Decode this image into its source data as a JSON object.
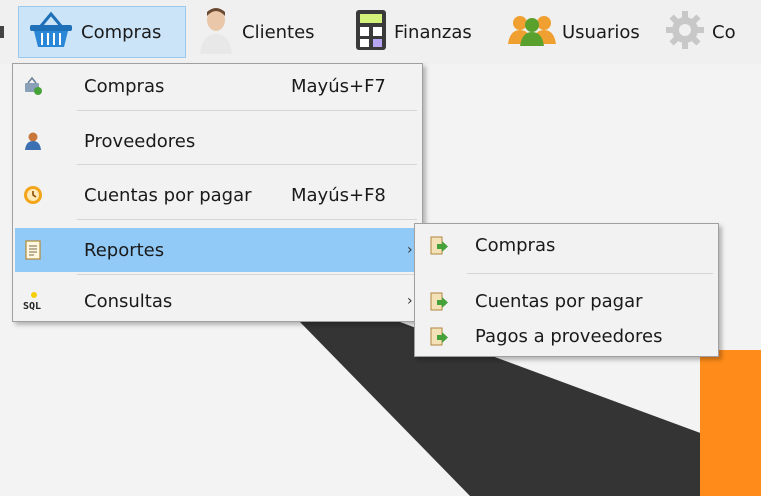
{
  "menubar": {
    "items": [
      {
        "label": "Compras",
        "icon": "basket-icon"
      },
      {
        "label": "Clientes",
        "icon": "person-icon"
      },
      {
        "label": "Finanzas",
        "icon": "calculator-icon"
      },
      {
        "label": "Usuarios",
        "icon": "users-icon"
      },
      {
        "label": "Co",
        "icon": "gear-icon"
      }
    ]
  },
  "compras_menu": {
    "items": [
      {
        "label": "Compras",
        "shortcut": "Mayús+F7",
        "icon": "purchase-icon"
      },
      {
        "label": "Proveedores",
        "shortcut": "",
        "icon": "supplier-icon"
      },
      {
        "label": "Cuentas por pagar",
        "shortcut": "Mayús+F8",
        "icon": "clock-icon"
      },
      {
        "label": "Reportes",
        "shortcut": "",
        "icon": "report-icon",
        "has_submenu": true,
        "highlighted": true
      },
      {
        "label": "Consultas",
        "shortcut": "",
        "icon": "sql-icon",
        "has_submenu": true
      }
    ]
  },
  "reportes_submenu": {
    "items": [
      {
        "label": "Compras",
        "icon": "report-export-icon"
      },
      {
        "label": "Cuentas por pagar",
        "icon": "report-export-icon"
      },
      {
        "label": "Pagos a proveedores",
        "icon": "report-export-icon"
      }
    ]
  },
  "arrow_glyph": "›",
  "sql_text": "SQL",
  "colors": {
    "menu_highlight": "#91c9f7",
    "menubar_active": "#cce4f7",
    "accent_orange": "#ff8c1a",
    "shape_dark": "#333333"
  }
}
